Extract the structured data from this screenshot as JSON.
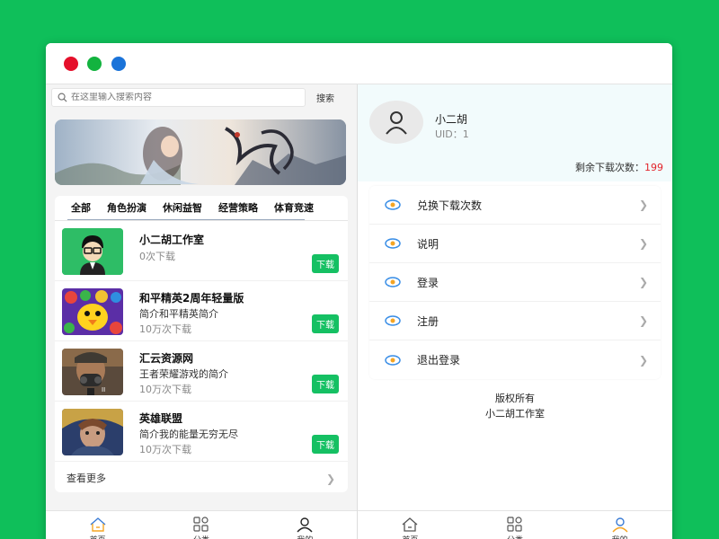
{
  "window": {
    "dots": [
      {
        "name": "close-dot",
        "color": "#e5102b"
      },
      {
        "name": "minimize-dot",
        "color": "#13b33f"
      },
      {
        "name": "maximize-dot",
        "color": "#1a73d9"
      }
    ]
  },
  "left": {
    "search": {
      "placeholder": "在这里输入搜索内容",
      "button": "搜索"
    },
    "tabs": [
      "全部",
      "角色扮演",
      "休闲益智",
      "经营策略",
      "体育竞速"
    ],
    "items": [
      {
        "name": "小二胡工作室",
        "desc": "",
        "count": "0次下载",
        "download": "下载",
        "thumb": "studio-avatar"
      },
      {
        "name": "和平精英2周年轻量版",
        "desc": "简介和平精英简介",
        "count": "10万次下载",
        "download": "下载",
        "thumb": "game-cartoon-bird"
      },
      {
        "name": "汇云资源网",
        "desc": "王者荣耀游戏的简介",
        "count": "10万次下载",
        "download": "下载",
        "thumb": "soldier-gasmask"
      },
      {
        "name": "英雄联盟",
        "desc": "简介我的能量无穷无尽",
        "count": "10万次下载",
        "download": "下载",
        "thumb": "hero-portrait"
      }
    ],
    "more": "查看更多"
  },
  "nav": [
    {
      "label": "首页",
      "icon": "home-icon",
      "active": true
    },
    {
      "label": "分类",
      "icon": "grid-icon",
      "active": false
    },
    {
      "label": "我的",
      "icon": "user-icon",
      "active": false
    }
  ],
  "nav_right": [
    {
      "label": "首页",
      "icon": "home-icon",
      "active": false
    },
    {
      "label": "分类",
      "icon": "grid-icon",
      "active": false
    },
    {
      "label": "我的",
      "icon": "user-icon",
      "active": true
    }
  ],
  "right": {
    "username": "小二胡",
    "uid": "UID：1",
    "remain_label": "剩余下载次数：",
    "remain_value": "199",
    "menu": [
      "兑换下载次数",
      "说明",
      "登录",
      "注册",
      "退出登录"
    ],
    "copyright_line1": "版权所有",
    "copyright_line2": "小二胡工作室"
  },
  "colors": {
    "background": "#0fbf5a",
    "download_button": "#15c063",
    "remain_number": "#e2232a",
    "tab_underline": "#3a7bd5",
    "menu_eye_blue": "#3a8ee6",
    "menu_eye_orange": "#f5a524"
  }
}
